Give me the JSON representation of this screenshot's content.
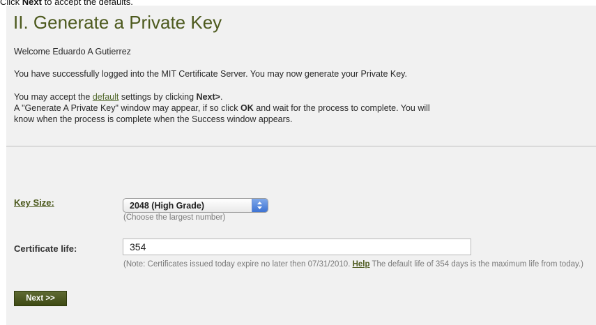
{
  "caption": {
    "click": "Click",
    "next": "Next",
    "rest": "to accept the defaults."
  },
  "header": {
    "title": "II. Generate a Private Key"
  },
  "intro": {
    "welcome": "Welcome Eduardo A Gutierrez",
    "logged_in": "You have successfully logged into the MIT Certificate Server. You may now generate your Private Key.",
    "accept_prefix": "You may accept the",
    "accept_link": "default",
    "accept_mid": "settings by clicking",
    "accept_next": "Next>",
    "accept_end": ".",
    "window_line_a": "A \"Generate A Private Key\" window may appear, if so click",
    "window_ok": "OK",
    "window_line_b": "and wait for the process to complete. You will",
    "window_line_c": "know when the process is complete when the Success window appears."
  },
  "form": {
    "key_size_label": "Key Size:",
    "key_size_value": "2048 (High Grade)",
    "key_size_hint": "(Choose the largest number)",
    "cert_life_label": "Certificate life:",
    "cert_life_value": "354",
    "note_a": "(Note: Certificates issued today expire no later then 07/31/2010.",
    "help_link": "Help",
    "note_b": "The default life of 354 days is the maximum life from today.)"
  },
  "actions": {
    "next_label": "Next >>"
  },
  "colors": {
    "accent": "#4d5a1e",
    "button": "#4a5620",
    "panel": "#f1f1f1"
  }
}
